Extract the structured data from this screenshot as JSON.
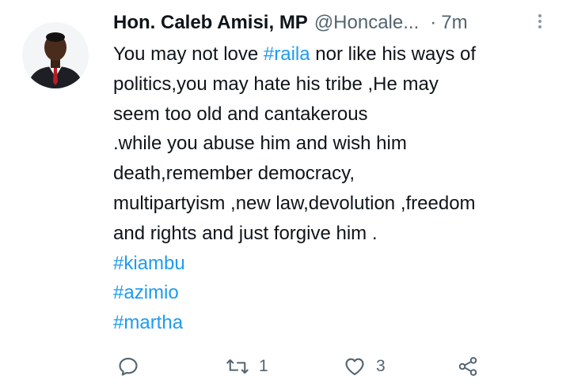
{
  "tweet": {
    "author_name": "Hon. Caleb Amisi, MP",
    "author_handle": "@Honcale...",
    "separator": "·",
    "time": "7m",
    "body_lines": [
      [
        {
          "t": "You may not love "
        },
        {
          "t": "#raila",
          "tag": true
        },
        {
          "t": " nor like his ways of"
        }
      ],
      [
        {
          "t": "politics,you may hate his tribe ,He may"
        }
      ],
      [
        {
          "t": "seem too old and cantakerous"
        }
      ],
      [
        {
          "t": ".while you abuse him and wish him"
        }
      ],
      [
        {
          "t": "death,remember democracy,"
        }
      ],
      [
        {
          "t": "multipartyism ,new law,devolution ,freedom"
        }
      ],
      [
        {
          "t": "and rights and just forgive him ."
        }
      ],
      [
        {
          "t": "#kiambu",
          "tag": true
        }
      ],
      [
        {
          "t": "#azimio",
          "tag": true
        }
      ],
      [
        {
          "t": "#martha",
          "tag": true
        }
      ]
    ]
  },
  "actions": {
    "reply_icon": "reply-icon",
    "retweet_icon": "retweet-icon",
    "retweet_count": "1",
    "like_icon": "heart-icon",
    "like_count": "3",
    "share_icon": "share-icon"
  },
  "colors": {
    "text": "#0f1419",
    "secondary": "#536471",
    "hashtag": "#1d9bf0",
    "background": "#ffffff"
  }
}
